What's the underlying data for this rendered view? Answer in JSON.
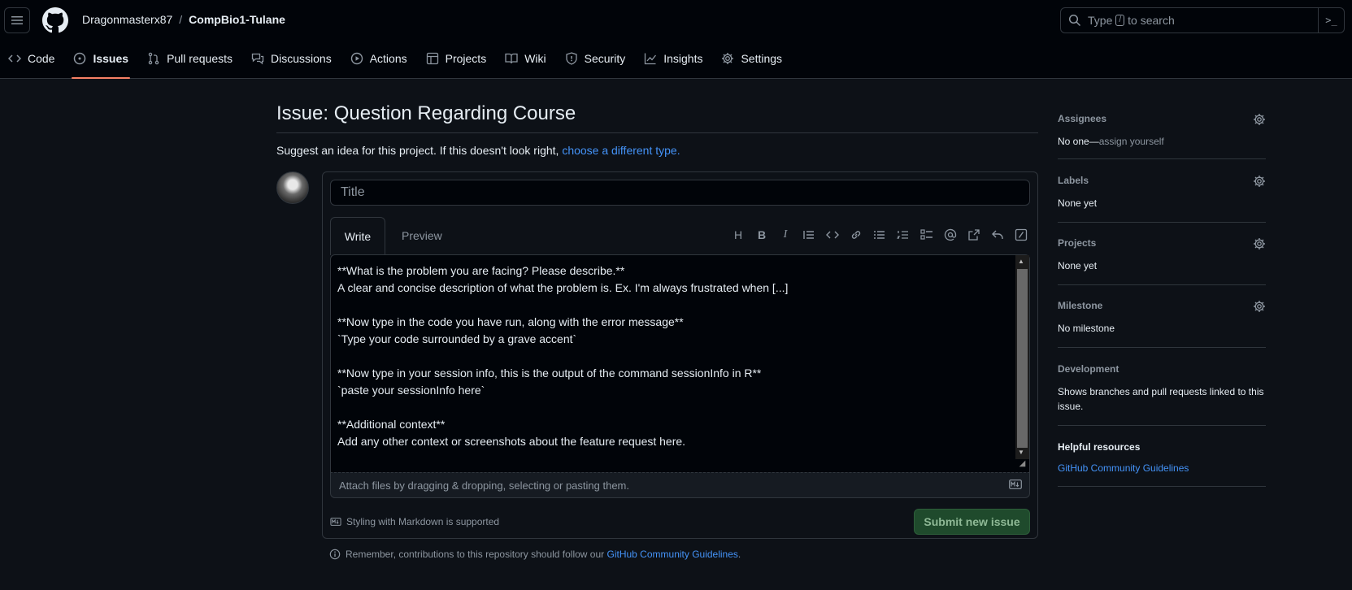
{
  "header": {
    "owner": "Dragonmasterx87",
    "separator": "/",
    "repo": "CompBio1-Tulane",
    "search_placeholder_pre": "Type",
    "search_slash": "/",
    "search_placeholder_post": "to search"
  },
  "nav": [
    {
      "label": "Code",
      "icon": "code-icon"
    },
    {
      "label": "Issues",
      "icon": "issue-icon",
      "active": true
    },
    {
      "label": "Pull requests",
      "icon": "pull-request-icon"
    },
    {
      "label": "Discussions",
      "icon": "discussions-icon"
    },
    {
      "label": "Actions",
      "icon": "play-icon"
    },
    {
      "label": "Projects",
      "icon": "table-icon"
    },
    {
      "label": "Wiki",
      "icon": "book-icon"
    },
    {
      "label": "Security",
      "icon": "shield-icon"
    },
    {
      "label": "Insights",
      "icon": "graph-icon"
    },
    {
      "label": "Settings",
      "icon": "gear-icon"
    }
  ],
  "issue": {
    "page_title": "Issue: Question Regarding Course",
    "hint_text": "Suggest an idea for this project. If this doesn't look right, ",
    "hint_link": "choose a different type.",
    "title_placeholder": "Title",
    "tab_write": "Write",
    "tab_preview": "Preview",
    "body": "**What is the problem you are facing? Please describe.**\nA clear and concise description of what the problem is. Ex. I'm always frustrated when [...]\n\n**Now type in the code you have run, along with the error message**\n`Type your code surrounded by a grave accent`\n\n**Now type in your session info, this is the output of the command sessionInfo in R**\n`paste your sessionInfo here`\n\n**Additional context**\nAdd any other context or screenshots about the feature request here.",
    "attach_text": "Attach files by dragging & dropping, selecting or pasting them.",
    "markdown_note": "Styling with Markdown is supported",
    "submit_label": "Submit new issue",
    "reminder_text": "Remember, contributions to this repository should follow our ",
    "reminder_link": "GitHub Community Guidelines",
    "reminder_end": "."
  },
  "sidebar": {
    "assignees_label": "Assignees",
    "assignees_value": "No one—",
    "assign_yourself": "assign yourself",
    "labels_label": "Labels",
    "labels_value": "None yet",
    "projects_label": "Projects",
    "projects_value": "None yet",
    "milestone_label": "Milestone",
    "milestone_value": "No milestone",
    "development_label": "Development",
    "development_value": "Shows branches and pull requests linked to this issue.",
    "helpful_label": "Helpful resources",
    "helpful_link": "GitHub Community Guidelines"
  },
  "colors": {
    "background": "#0d1117",
    "header": "#010409",
    "accent": "#f78166",
    "link": "#4493f8",
    "submit_bg": "#1f4a2c"
  }
}
